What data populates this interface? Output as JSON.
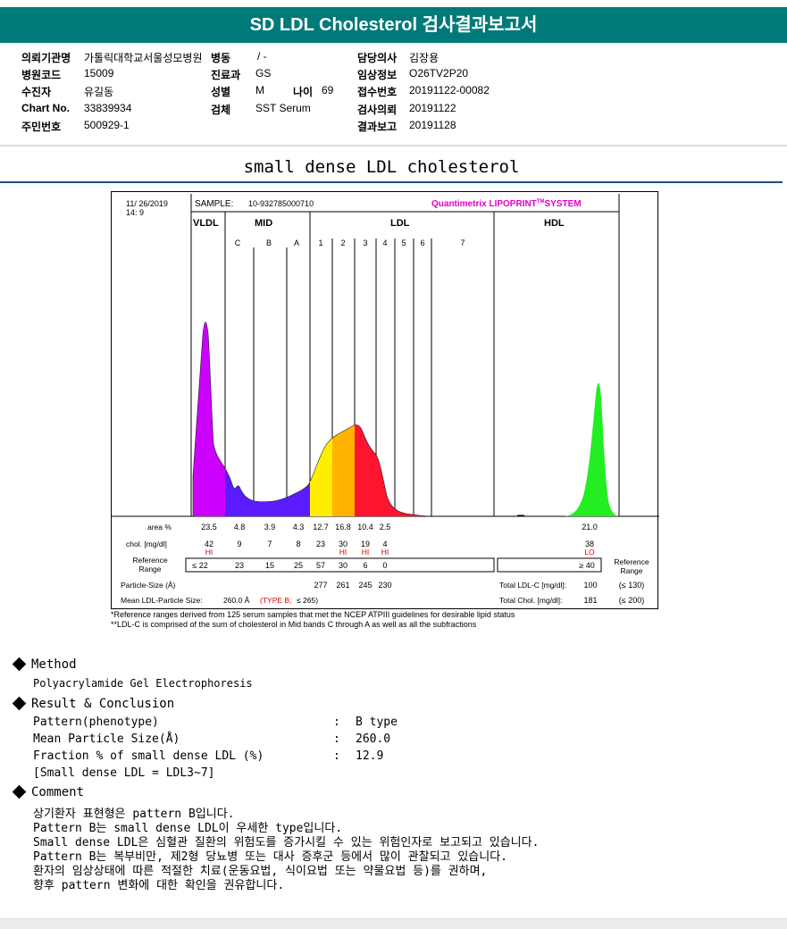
{
  "header": {
    "title": "SD LDL Cholesterol 검사결과보고서"
  },
  "info": {
    "institution_label": "의뢰기관명",
    "institution_value": "가톨릭대학교서울성모병원",
    "ward_label": "병동",
    "ward_value": "/ -",
    "doctor_label": "담당의사",
    "doctor_value": "김장용",
    "hospital_code_label": "병원코드",
    "hospital_code_value": "15009",
    "dept_label": "진료과",
    "dept_value": "GS",
    "clinical_info_label": "임상정보",
    "clinical_info_value": "O26TV2P20",
    "patient_label": "수진자",
    "patient_value": "유길동",
    "sex_label": "성별",
    "sex_value": "M",
    "age_label": "나이",
    "age_value": "69",
    "receipt_label": "접수번호",
    "receipt_value": "20191122-00082",
    "chart_label": "Chart No.",
    "chart_value": "33839934",
    "specimen_label": "검체",
    "specimen_value": "SST Serum",
    "request_label": "검사의뢰",
    "request_value": "20191122",
    "rrn_label": "주민번호",
    "rrn_value": "500929-1",
    "report_label": "결과보고",
    "report_value": "20191128"
  },
  "section_title": "small dense LDL cholesterol",
  "report": {
    "date": "11/ 26/2019",
    "time": "14: 9",
    "sample_label": "SAMPLE:",
    "sample_value": "10-932785000710",
    "brand": "Quantimetrix LIPOPRINT",
    "brand_tm": "TM",
    "brand_suffix": "SYSTEM",
    "band_groups": [
      "VLDL",
      "MID",
      "LDL",
      "HDL"
    ],
    "band_labels": [
      "C",
      "B",
      "A",
      "1",
      "2",
      "3",
      "4",
      "5",
      "6",
      "7"
    ],
    "area_label": "area %",
    "area_values": [
      "23.5",
      "4.8",
      "3.9",
      "4.3",
      "12.7",
      "16.8",
      "10.4",
      "2.5",
      "21.0"
    ],
    "chol_label": "chol. [mg/dl]",
    "chol_values": [
      "42",
      "9",
      "7",
      "8",
      "23",
      "30",
      "19",
      "4",
      "38"
    ],
    "chol_flags": [
      "HI",
      "HI",
      "HI",
      "HI",
      "LO"
    ],
    "ref_label_1": "Reference",
    "ref_label_2": "Range",
    "ref_values": [
      "≤ 22",
      "23",
      "15",
      "25",
      "57",
      "30",
      "6",
      "0",
      "≥ 40"
    ],
    "ref_right_1": "Reference",
    "ref_right_2": "Range",
    "particle_label": "Particle-Size (Å)",
    "particle_values": [
      "277",
      "261",
      "245",
      "230"
    ],
    "mean_label": "Mean LDL-Particle Size:",
    "mean_value": "260.0 Å",
    "mean_type": "(TYPE B;",
    "mean_ref": "≤ 265)",
    "total_ldl_label": "Total LDL-C [mg/dl]:",
    "total_ldl_value": "100",
    "total_ldl_ref": "(≤ 130)",
    "total_chol_label": "Total Chol. [mg/dl]:",
    "total_chol_value": "181",
    "total_chol_ref": "(≤ 200)"
  },
  "footnote": {
    "line1": "*Reference ranges derived from 125 serum samples that met the NCEP ATPIII guidelines for desirable lipid status",
    "line2": "**LDL-C is comprised of the sum of cholesterol in Mid bands C through A as well as all the subfractions"
  },
  "method": {
    "title": "Method",
    "text": "Polyacrylamide Gel Electrophoresis"
  },
  "result": {
    "title": "Result & Conclusion",
    "rows": [
      {
        "label": "Pattern(phenotype)",
        "sep": ":",
        "value": "B type"
      },
      {
        "label": "Mean Particle Size(Å)",
        "sep": ":",
        "value": "260.0"
      },
      {
        "label": "Fraction % of small dense LDL (%)",
        "sep": ":",
        "value": "12.9"
      }
    ],
    "note": "[Small dense LDL = LDL3~7]"
  },
  "comment": {
    "title": "Comment",
    "lines": [
      "상기환자 표현형은 pattern B입니다.",
      "Pattern B는 small dense LDL이 우세한 type입니다.",
      "Small dense LDL은 심혈관 질환의 위험도를 증가시킬 수 있는 위험인자로 보고되고 있습니다.",
      "Pattern B는 복부비만, 제2형 당뇨병 또는 대사 증후군 등에서 많이 관찰되고 있습니다.",
      "환자의 임상상태에 따른 적절한 치료(운동요법, 식이요법 또는 약물요법 등)를 권하며,",
      "향후 pattern 변화에 대한 확인을 권유합니다."
    ]
  },
  "colors": {
    "header": "#007a78",
    "vldl": "#cc00ff",
    "mid": "#5a1bff",
    "ldl1": "#ffee00",
    "ldl2": "#ffb400",
    "ldl3": "#ff1430",
    "hdl": "#22ee22",
    "flag": "#e00000",
    "brand": "#e000c8"
  }
}
